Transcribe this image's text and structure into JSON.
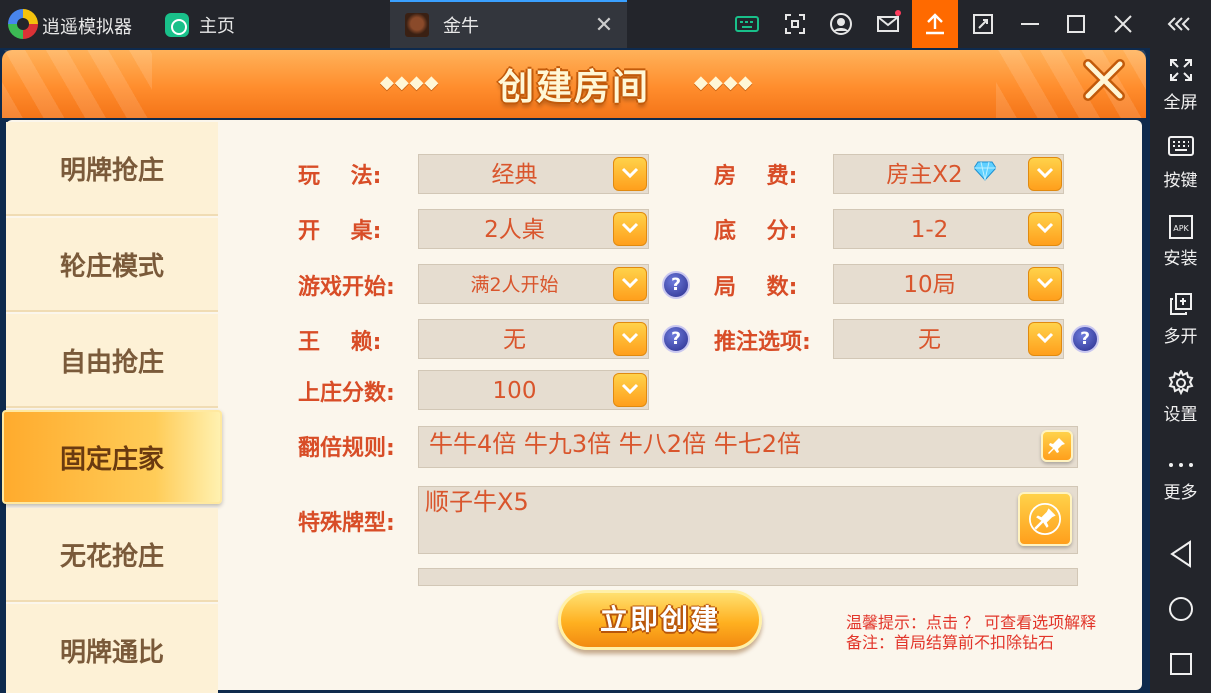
{
  "titlebar": {
    "app_name": "逍遥模拟器",
    "home_tab_label": "主页",
    "game_tab_label": "金牛",
    "close_glyph": "✕",
    "icons": [
      "keyboard-icon",
      "screenshot-icon",
      "account-icon",
      "mail-icon",
      "upload-icon",
      "screen-rotate-icon",
      "minimize-icon",
      "maximize-icon",
      "close-icon",
      "collapse-icon"
    ]
  },
  "sidebar": {
    "items": [
      {
        "label": "全屏",
        "icon": "fullscreen-icon"
      },
      {
        "label": "按键",
        "icon": "keymap-icon"
      },
      {
        "label": "安装",
        "icon": "apk-icon"
      },
      {
        "label": "多开",
        "icon": "multi-instance-icon"
      },
      {
        "label": "设置",
        "icon": "settings-icon"
      },
      {
        "label": "更多",
        "icon": "more-icon"
      }
    ],
    "nav": [
      "back-icon",
      "home-icon",
      "recents-icon"
    ]
  },
  "dialog": {
    "title": "创建房间",
    "left_deco": "◆◆◆◆",
    "right_deco": "◆◆◆◆",
    "modes": [
      {
        "label": "明牌抢庄",
        "active": false
      },
      {
        "label": "轮庄模式",
        "active": false
      },
      {
        "label": "自由抢庄",
        "active": false
      },
      {
        "label": "固定庄家",
        "active": true
      },
      {
        "label": "无花抢庄",
        "active": false
      },
      {
        "label": "明牌通比",
        "active": false
      }
    ],
    "fields": {
      "play_label": "玩    法:",
      "play_value": "经典",
      "tables_label": "开    桌:",
      "tables_value": "2人桌",
      "start_label": "游戏开始:",
      "start_value": "满2人开始",
      "joker_label": "王    赖:",
      "joker_value": "无",
      "banker_score_label": "上庄分数:",
      "banker_score_value": "100",
      "fee_label": "房    费:",
      "fee_value": "房主X2",
      "base_label": "底    分:",
      "base_value": "1-2",
      "rounds_label": "局    数:",
      "rounds_value": "10局",
      "push_label": "推注选项:",
      "push_value": "无",
      "multiplier_label": "翻倍规则:",
      "multiplier_value": "牛牛4倍 牛九3倍 牛八2倍 牛七2倍",
      "special_label": "特殊牌型:",
      "special_value": "顺子牛X5"
    },
    "help_glyph": "?",
    "create_button": "立即创建",
    "tip_1": "温馨提示：点击 ？  可查看选项解释",
    "tip_2": "备注：首局结算前不扣除钻石"
  }
}
